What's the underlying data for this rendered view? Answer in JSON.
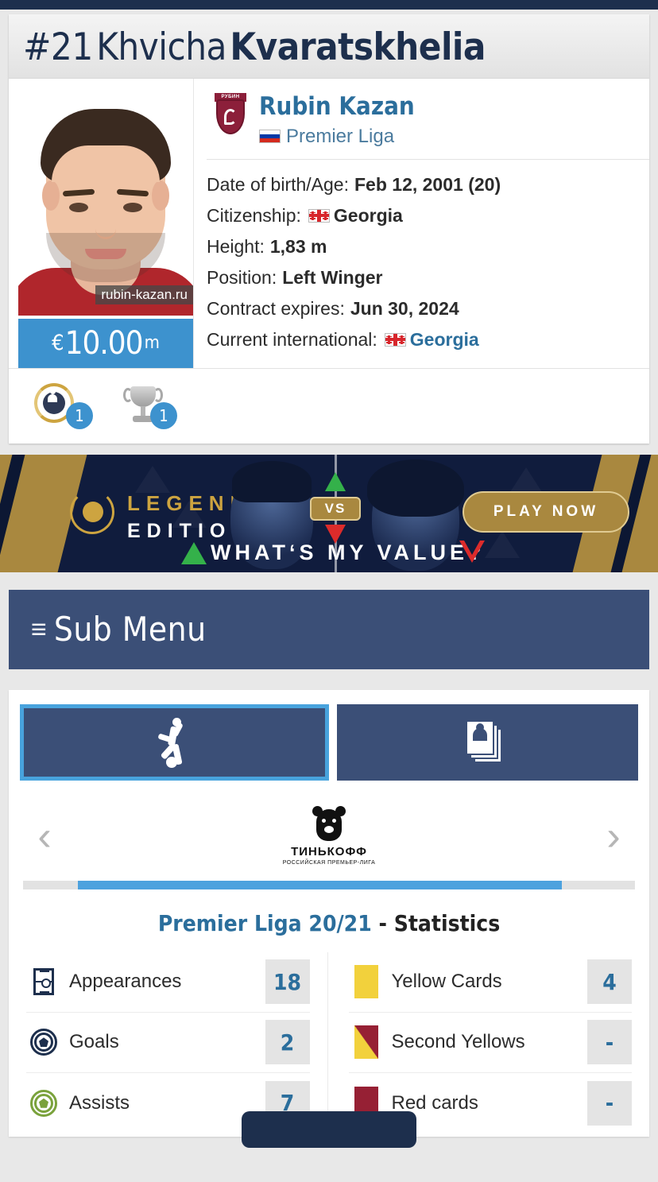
{
  "player": {
    "shirt_number": "#21",
    "first_name": "Khvicha",
    "last_name": "Kvaratskhelia",
    "photo_watermark": "rubin-kazan.ru",
    "market_value": {
      "currency": "€",
      "amount": "10.00",
      "suffix": "m"
    },
    "club": {
      "name": "Rubin Kazan",
      "crest_label": "РУБИН",
      "league": "Premier Liga",
      "league_flag": "russia-flag"
    },
    "facts": [
      {
        "label": "Date of birth/Age:",
        "value": "Feb 12, 2001 (20)",
        "flag": null,
        "link": false
      },
      {
        "label": "Citizenship:",
        "value": "Georgia",
        "flag": "georgia-flag",
        "link": false
      },
      {
        "label": "Height:",
        "value": "1,83 m",
        "flag": null,
        "link": false
      },
      {
        "label": "Position:",
        "value": "Left Winger",
        "flag": null,
        "link": false
      },
      {
        "label": "Contract expires:",
        "value": "Jun 30, 2024",
        "flag": null,
        "link": false
      },
      {
        "label": "Current international:",
        "value": "Georgia",
        "flag": "georgia-flag",
        "link": true
      }
    ],
    "badges": [
      {
        "icon": "player-of-the-year-laurel-icon",
        "count": "1"
      },
      {
        "icon": "trophy-icon",
        "count": "1"
      }
    ]
  },
  "ad": {
    "legends": "LEGENDS",
    "edition": "EDITION",
    "vs": "VS",
    "question": "WHAT‘S MY VALUE?",
    "cta": "PLAY NOW"
  },
  "submenu": {
    "label": "Sub Menu",
    "icon": "hamburger-icon"
  },
  "tabs": [
    {
      "id": "performance",
      "icon": "player-kicking-ball-icon",
      "active": true
    },
    {
      "id": "cards",
      "icon": "stacked-player-cards-icon",
      "active": false
    }
  ],
  "carousel": {
    "prev": "‹",
    "next": "›",
    "competition_logo": "tinkoff-bear-logo",
    "competition_name": "ТИНЬКОФФ",
    "competition_sub": "РОССИЙСКАЯ ПРЕМЬЕР-ЛИГА",
    "progress_start_pct": 9,
    "progress_width_pct": 79
  },
  "stats": {
    "title_competition": "Premier Liga 20/21",
    "title_separator": " - ",
    "title_word": "Statistics",
    "left": [
      {
        "icon": "pitch-icon",
        "label": "Appearances",
        "value": "18"
      },
      {
        "icon": "ball-navy-icon",
        "label": "Goals",
        "value": "2"
      },
      {
        "icon": "ball-green-icon",
        "label": "Assists",
        "value": "7"
      }
    ],
    "right": [
      {
        "icon": "yellow-card-icon",
        "label": "Yellow Cards",
        "value": "4"
      },
      {
        "icon": "second-yellow-card-icon",
        "label": "Second Yellows",
        "value": "-"
      },
      {
        "icon": "red-card-icon",
        "label": "Red cards",
        "value": "-"
      }
    ]
  },
  "colors": {
    "brand_navy": "#1d2f4d",
    "accent_blue": "#3d92ce",
    "link_blue": "#2b6e9c",
    "submenu_navy": "#3b4f77",
    "yellow_card": "#f2d13c",
    "red_card": "#962034",
    "gold": "#a9883f"
  }
}
